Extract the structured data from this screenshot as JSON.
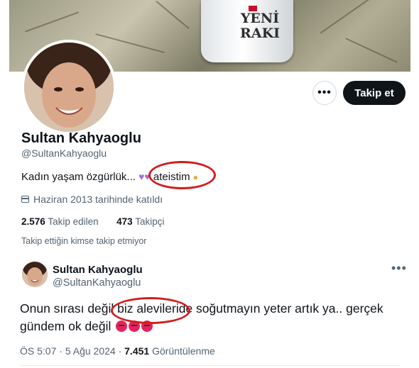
{
  "banner": {
    "brand_text": "YENİ RAKI"
  },
  "profile": {
    "name": "Sultan Kahyaoglu",
    "handle": "@SultanKahyaoglu",
    "bio_text": "Kadın yaşam özgürlük...",
    "bio_keyword": "ateistim",
    "joined": "Haziran 2013 tarihinde katıldı",
    "following_count": "2.576",
    "following_label": "Takip edilen",
    "followers_count": "473",
    "followers_label": "Takipçi",
    "mutuals_note": "Takip ettiğin kimse takip etmiyor"
  },
  "actions": {
    "more_icon": "more-horizontal-icon",
    "follow_label": "Takip et"
  },
  "tweet": {
    "author_name": "Sultan Kahyaoglu",
    "author_handle": "@SultanKahyaoglu",
    "text_part1": "Onun sırası değil ",
    "text_highlight": "biz alevileride",
    "text_part2": " soğutmayın yeter artık ya.. gerçek",
    "text_line2": "gündem ok değil",
    "time": "ÖS 5:07",
    "date": "5 Ağu 2024",
    "views_count": "7.451",
    "views_label": "Görüntülenme"
  },
  "colors": {
    "annotation_red": "#d31d1d",
    "follow_bg": "#0f1419",
    "muted_text": "#536471"
  }
}
